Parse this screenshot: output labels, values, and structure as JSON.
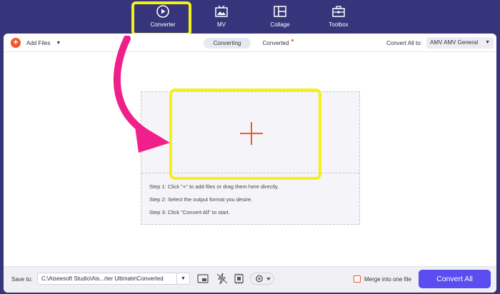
{
  "nav": {
    "items": [
      {
        "label": "Converter",
        "icon": "converter-icon",
        "active": true
      },
      {
        "label": "MV",
        "icon": "mv-icon"
      },
      {
        "label": "Collage",
        "icon": "collage-icon"
      },
      {
        "label": "Toolbox",
        "icon": "toolbox-icon"
      }
    ]
  },
  "toolbar": {
    "add_files_label": "Add Files",
    "tabs": [
      {
        "label": "Converting",
        "active": true
      },
      {
        "label": "Converted",
        "has_dot": true
      }
    ],
    "convert_all_to_label": "Convert All to:",
    "format_value": "AMV AMV General"
  },
  "drop_area": {
    "steps": [
      "Step 1: Click \"+\" to add files or drag them here directly.",
      "Step 2: Select the output format you desire.",
      "Step 3: Click \"Convert All\" to start."
    ]
  },
  "bottom": {
    "save_to_label": "Save to:",
    "path_value": "C:\\Aiseesoft Studio\\Ais...rter Ultimate\\Converted",
    "merge_label": "Merge into one file",
    "convert_all_label": "Convert All"
  },
  "colors": {
    "nav_bg": "#36347a",
    "accent_orange": "#f0582c",
    "primary_button": "#5a4ef0",
    "highlight_yellow": "#f5f01a",
    "arrow_pink": "#f0208a"
  }
}
